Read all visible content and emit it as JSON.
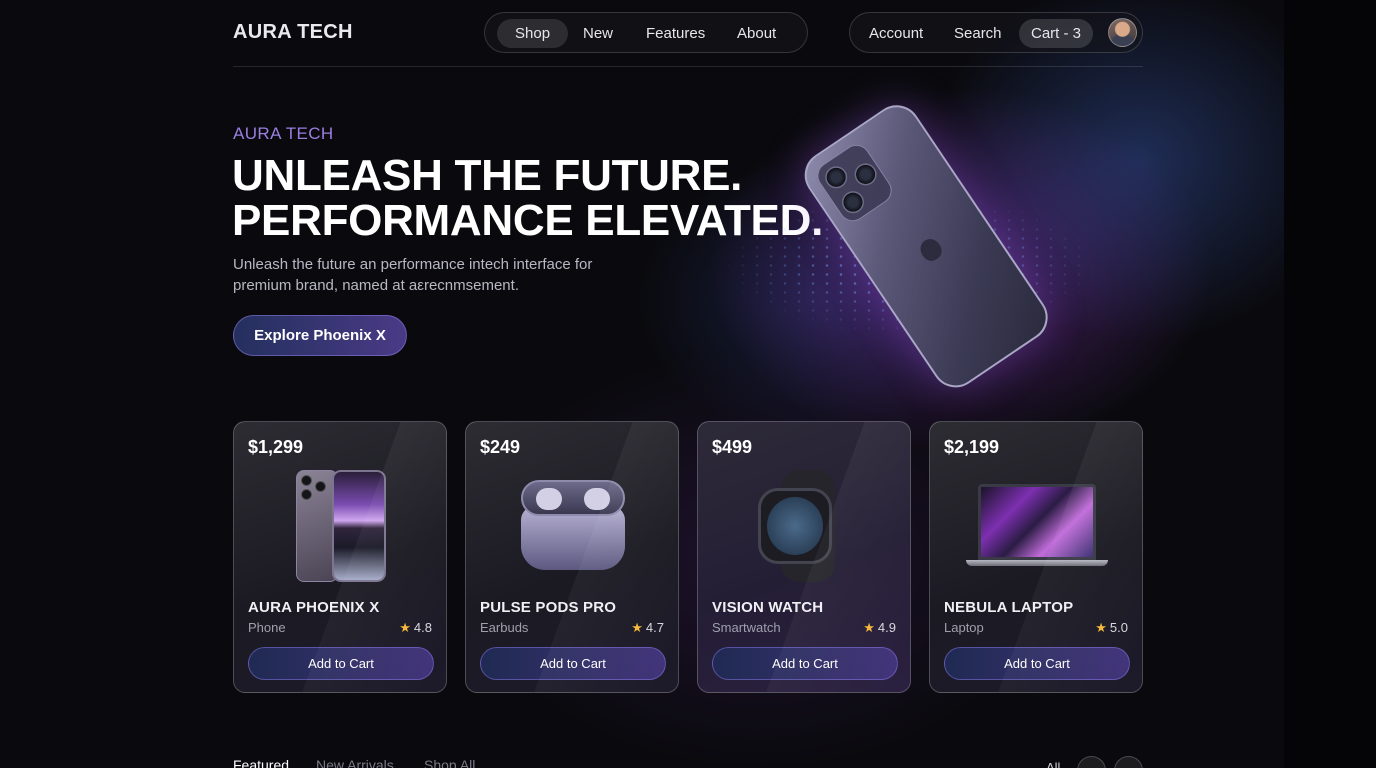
{
  "brand": {
    "logo": "AURA TECH"
  },
  "nav": {
    "items": [
      {
        "label": "Shop",
        "active": true
      },
      {
        "label": "New",
        "active": false
      },
      {
        "label": "Features",
        "active": false
      },
      {
        "label": "About",
        "active": false
      }
    ]
  },
  "account_bar": {
    "account": "Account",
    "search": "Search",
    "cart": "Cart - 3"
  },
  "hero": {
    "eyebrow": "AURA TECH",
    "headline_line1": "UNLEASH THE FUTURE.",
    "headline_line2": "PERFORMANCE ELEVATED.",
    "subtext": "Unleash the future an performance intech interface for premium brand, named at aεrecnmsement.",
    "cta": "Explore Phoenix X"
  },
  "products": [
    {
      "price": "$1,299",
      "name": "AURA PHOENIX X",
      "category": "Phone",
      "rating": "4.8",
      "button": "Add to Cart"
    },
    {
      "price": "$249",
      "name": "PULSE PODS PRO",
      "category": "Earbuds",
      "rating": "4.7",
      "button": "Add to Cart"
    },
    {
      "price": "$499",
      "name": "VISION WATCH",
      "category": "Smartwatch",
      "rating": "4.9",
      "button": "Add to Cart"
    },
    {
      "price": "$2,199",
      "name": "NEBULA LAPTOP",
      "category": "Laptop",
      "rating": "5.0",
      "button": "Add to Cart"
    }
  ],
  "bottom_tabs": {
    "items": [
      {
        "label": "Featured",
        "active": true
      },
      {
        "label": "New Arrivals",
        "active": false
      },
      {
        "label": "Shop All",
        "active": false
      }
    ],
    "all_label": "All",
    "prev_icon": "chevron-left-icon",
    "next_icon": "chevron-right-icon"
  },
  "colors": {
    "background": "#0a0a0e",
    "accent_purple": "#9a7fe0",
    "star": "#f5b83b",
    "button_gradient_start": "#1f2a52",
    "button_gradient_end": "#42347a"
  }
}
